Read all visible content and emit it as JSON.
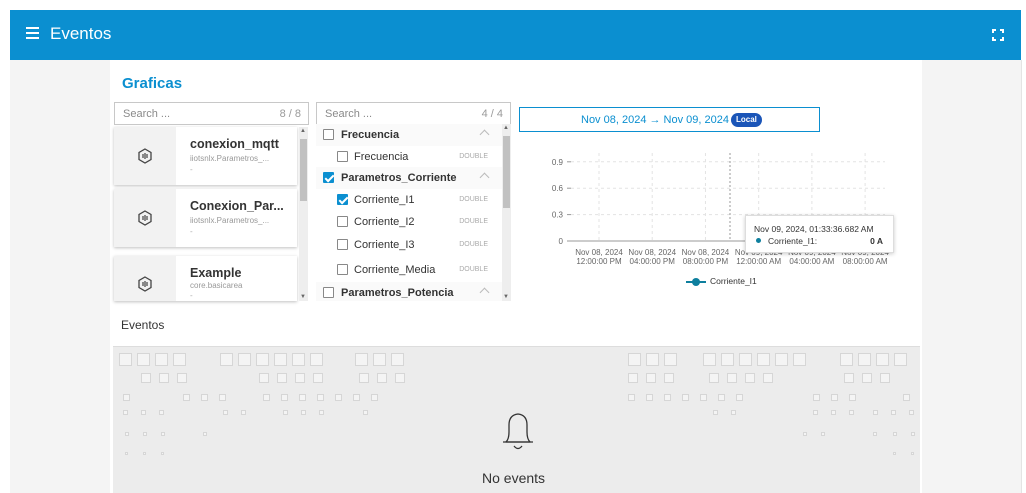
{
  "app": {
    "title": "Eventos",
    "menu_icon": "hamburger-icon",
    "fullscreen_icon": "fullscreen-icon"
  },
  "graficas": {
    "title": "Graficas",
    "assets_search": {
      "placeholder": "Search ...",
      "count": "8 / 8"
    },
    "assets": [
      {
        "name": "conexion_mqtt",
        "type": "iiotsnlx.Parametros_...",
        "extra": "-"
      },
      {
        "name": "Conexion_Par...",
        "type": "iiotsnlx.Parametros_...",
        "extra": "-"
      },
      {
        "name": "Example",
        "type": "core.basicarea",
        "extra": "-"
      }
    ],
    "variables_search": {
      "placeholder": "Search ...",
      "count": "4 / 4"
    },
    "variables": [
      {
        "label": "Frecuencia",
        "group": true,
        "checked": false
      },
      {
        "label": "Frecuencia",
        "type": "DOUBLE",
        "checked": false
      },
      {
        "label": "Parametros_Corriente",
        "group": true,
        "checked": true
      },
      {
        "label": "Corriente_I1",
        "type": "DOUBLE",
        "checked": true
      },
      {
        "label": "Corriente_I2",
        "type": "DOUBLE",
        "checked": false
      },
      {
        "label": "Corriente_I3",
        "type": "DOUBLE",
        "checked": false
      },
      {
        "label": "Corriente_Media",
        "type": "DOUBLE",
        "checked": false
      },
      {
        "label": "Parametros_Potencia",
        "group": true,
        "checked": false
      }
    ],
    "date_range": {
      "text": "Nov 08, 2024 → Nov 09, 2024",
      "badge": "Local"
    }
  },
  "chart_data": {
    "type": "line",
    "y_ticks": [
      "0.9",
      "0.6",
      "0.3",
      "0"
    ],
    "ylim": [
      0,
      1
    ],
    "x_ticks": [
      {
        "date": "Nov 08, 2024",
        "time": "12:00:00 PM"
      },
      {
        "date": "Nov 08, 2024",
        "time": "04:00:00 PM"
      },
      {
        "date": "Nov 08, 2024",
        "time": "08:00:00 PM"
      },
      {
        "date": "Nov 09, 2024",
        "time": "12:00:00 AM"
      },
      {
        "date": "Nov 09, 2024",
        "time": "04:00:00 AM"
      },
      {
        "date": "Nov 09, 2024",
        "time": "08:00:00 AM"
      }
    ],
    "series": [
      {
        "name": "Corriente_I1",
        "color": "#0e7f9e",
        "values": []
      }
    ],
    "grid": true,
    "legend_position": "bottom",
    "tooltip": {
      "title": "Nov 09, 2024, 01:33:36.682 AM",
      "series": "Corriente_I1:",
      "value": "0 A"
    }
  },
  "eventos": {
    "title": "Eventos",
    "empty_text": "No events",
    "empty_icon": "bell-icon"
  }
}
